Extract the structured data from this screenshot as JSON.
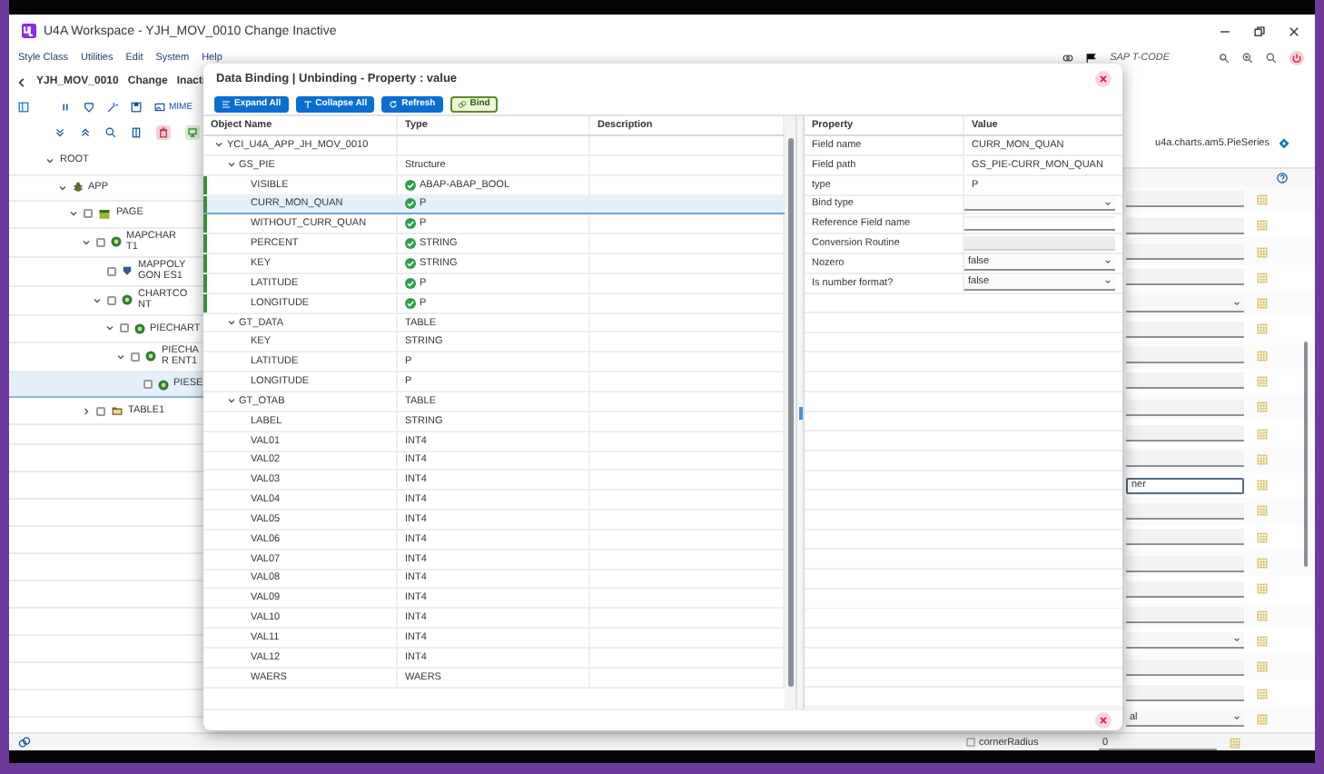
{
  "window": {
    "title": "U4A Workspace - YJH_MOV_0010 Change Inactive"
  },
  "menu": [
    "Style Class",
    "Utilities",
    "Edit",
    "System",
    "Help"
  ],
  "tcode": "SAP T-CODE",
  "header": {
    "program": "YJH_MOV_0010",
    "mode": "Change",
    "status": "Inacti"
  },
  "toolbar": {
    "mime_label": "MIME"
  },
  "tree": [
    {
      "label": "ROOT",
      "expanded": true,
      "selected": false,
      "children": [
        {
          "label": "APP",
          "kind": "app",
          "expanded": true,
          "selected": false,
          "children": [
            {
              "label": "PAGE",
              "kind": "page",
              "checked": false,
              "expanded": true,
              "selected": false,
              "children": [
                {
                  "label": "MAPCHART1",
                  "kind": "control",
                  "checked": false,
                  "expanded": true,
                  "selected": false,
                  "children": [
                    {
                      "label": "MAPPOLYGON ES1",
                      "kind": "shape",
                      "checked": false,
                      "selected": false
                    },
                    {
                      "label": "CHARTCONT",
                      "kind": "control",
                      "checked": false,
                      "expanded": true,
                      "selected": false,
                      "children": [
                        {
                          "label": "PIECHART",
                          "kind": "control",
                          "checked": false,
                          "expanded": true,
                          "selected": false,
                          "children": [
                            {
                              "label": "PIECHAR ENT1",
                              "kind": "control",
                              "checked": false,
                              "expanded": true,
                              "selected": false,
                              "children": [
                                {
                                  "label": "PIESE",
                                  "kind": "control",
                                  "checked": false,
                                  "selected": true
                                }
                              ]
                            }
                          ]
                        }
                      ]
                    }
                  ]
                },
                {
                  "label": "TABLE1",
                  "kind": "folder",
                  "checked": false,
                  "expanded": false,
                  "selected": false
                }
              ]
            }
          ]
        }
      ]
    }
  ],
  "side": {
    "class_name": "u4a.charts.am5.PieSeries",
    "fields": [
      {
        "kind": "input"
      },
      {
        "kind": "input"
      },
      {
        "kind": "input"
      },
      {
        "kind": "input"
      },
      {
        "kind": "select"
      },
      {
        "kind": "input"
      },
      {
        "kind": "input"
      },
      {
        "kind": "input"
      },
      {
        "kind": "input"
      },
      {
        "kind": "input"
      },
      {
        "kind": "input"
      },
      {
        "kind": "focused",
        "value": "ner"
      },
      {
        "kind": "input"
      },
      {
        "kind": "input"
      },
      {
        "kind": "input"
      },
      {
        "kind": "input"
      },
      {
        "kind": "input"
      },
      {
        "kind": "select"
      },
      {
        "kind": "input"
      },
      {
        "kind": "input"
      },
      {
        "kind": "select",
        "value": "al"
      }
    ]
  },
  "bottom_row": {
    "label": "cornerRadius",
    "value": "0"
  },
  "dialog": {
    "title": "Data Binding | Unbinding - Property : value",
    "buttons": [
      {
        "label": "Expand All",
        "kind": "expand"
      },
      {
        "label": "Collapse All",
        "kind": "collapse"
      },
      {
        "label": "Refresh",
        "kind": "refresh"
      },
      {
        "label": "Bind",
        "kind": "bind"
      }
    ],
    "columns": [
      "Object Name",
      "Type",
      "Description"
    ],
    "rows": [
      {
        "name": "YCI_U4A_APP_JH_MOV_0010",
        "expanded": true,
        "selected": false,
        "children": [
          {
            "name": "GS_PIE",
            "type": "Structure",
            "expanded": true,
            "selected": false,
            "children": [
              {
                "name": "VISIBLE",
                "type": "ABAP-ABAP_BOOL",
                "bound": true,
                "selected": false
              },
              {
                "name": "CURR_MON_QUAN",
                "type": "P",
                "bound": true,
                "selected": true
              },
              {
                "name": "WITHOUT_CURR_QUAN",
                "type": "P",
                "bound": true,
                "selected": false
              },
              {
                "name": "PERCENT",
                "type": "STRING",
                "bound": true,
                "selected": false
              },
              {
                "name": "KEY",
                "type": "STRING",
                "bound": true,
                "selected": false
              },
              {
                "name": "LATITUDE",
                "type": "P",
                "bound": true,
                "selected": false
              },
              {
                "name": "LONGITUDE",
                "type": "P",
                "bound": true,
                "selected": false
              }
            ]
          },
          {
            "name": "GT_DATA",
            "type": "TABLE",
            "expanded": true,
            "selected": false,
            "children": [
              {
                "name": "KEY",
                "type": "STRING",
                "bound": false,
                "selected": false
              },
              {
                "name": "LATITUDE",
                "type": "P",
                "bound": false,
                "selected": false
              },
              {
                "name": "LONGITUDE",
                "type": "P",
                "bound": false,
                "selected": false
              }
            ]
          },
          {
            "name": "GT_OTAB",
            "type": "TABLE",
            "expanded": true,
            "selected": false,
            "children": [
              {
                "name": "LABEL",
                "type": "STRING",
                "bound": false,
                "selected": false
              },
              {
                "name": "VAL01",
                "type": "INT4",
                "bound": false,
                "selected": false
              },
              {
                "name": "VAL02",
                "type": "INT4",
                "bound": false,
                "selected": false
              },
              {
                "name": "VAL03",
                "type": "INT4",
                "bound": false,
                "selected": false
              },
              {
                "name": "VAL04",
                "type": "INT4",
                "bound": false,
                "selected": false
              },
              {
                "name": "VAL05",
                "type": "INT4",
                "bound": false,
                "selected": false
              },
              {
                "name": "VAL06",
                "type": "INT4",
                "bound": false,
                "selected": false
              },
              {
                "name": "VAL07",
                "type": "INT4",
                "bound": false,
                "selected": false
              },
              {
                "name": "VAL08",
                "type": "INT4",
                "bound": false,
                "selected": false
              },
              {
                "name": "VAL09",
                "type": "INT4",
                "bound": false,
                "selected": false
              },
              {
                "name": "VAL10",
                "type": "INT4",
                "bound": false,
                "selected": false
              },
              {
                "name": "VAL11",
                "type": "INT4",
                "bound": false,
                "selected": false
              },
              {
                "name": "VAL12",
                "type": "INT4",
                "bound": false,
                "selected": false
              },
              {
                "name": "WAERS",
                "type": "WAERS",
                "bound": false,
                "selected": false
              }
            ]
          }
        ]
      }
    ],
    "property_columns": [
      "Property",
      "Value"
    ],
    "properties": [
      {
        "label": "Field name",
        "kind": "text",
        "value": "CURR_MON_QUAN"
      },
      {
        "label": "Field path",
        "kind": "text",
        "value": "GS_PIE-CURR_MON_QUAN"
      },
      {
        "label": "type",
        "kind": "text",
        "value": "P"
      },
      {
        "label": "Bind type",
        "kind": "select"
      },
      {
        "label": "Reference Field name",
        "kind": "input"
      },
      {
        "label": "Conversion Routine",
        "kind": "disabled"
      },
      {
        "label": "Nozero",
        "kind": "select",
        "value": "false"
      },
      {
        "label": "Is number format?",
        "kind": "select",
        "value": "false"
      }
    ]
  }
}
